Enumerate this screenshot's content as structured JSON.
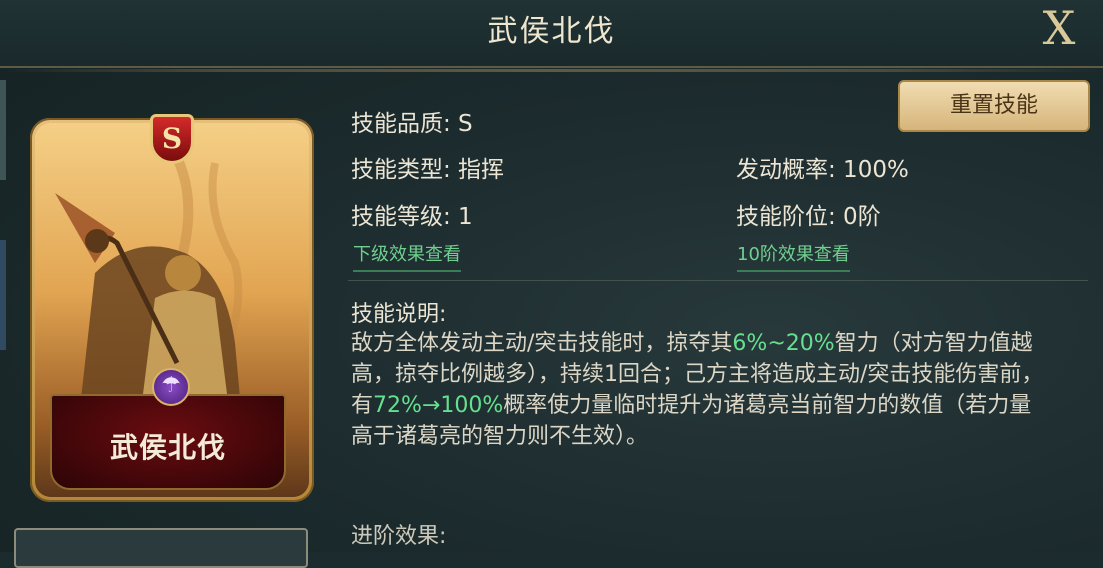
{
  "header": {
    "title": "武侯北伐",
    "close_label": "X"
  },
  "card": {
    "grade": "S",
    "name": "武侯北伐"
  },
  "info": {
    "quality": "技能品质: S",
    "type": "技能类型: 指挥",
    "level": "技能等级: 1",
    "trigger": "发动概率: 100%",
    "tier": "技能阶位: 0阶",
    "next_level_link": "下级效果查看",
    "tier10_link": "10阶效果查看",
    "reset_button": "重置技能"
  },
  "description": {
    "title": "技能说明:",
    "p1": "敌方全体发动主动/突击技能时，掠夺其",
    "h1": "6%~20%",
    "p2": "智力（对方智力值越高，掠夺比例越多），持续1回合；己方主将造成主动/突击技能伤害前，有",
    "h2": "72%→100%",
    "p3": "概率使力量临时提升为诸葛亮当前智力的数值（若力量高于诸葛亮的智力则不生效）。"
  },
  "advance": {
    "title": "进阶效果:"
  },
  "colors": {
    "highlight": "#65e08f",
    "accent": "#d6b57a",
    "panel": "#1c2c2e"
  }
}
